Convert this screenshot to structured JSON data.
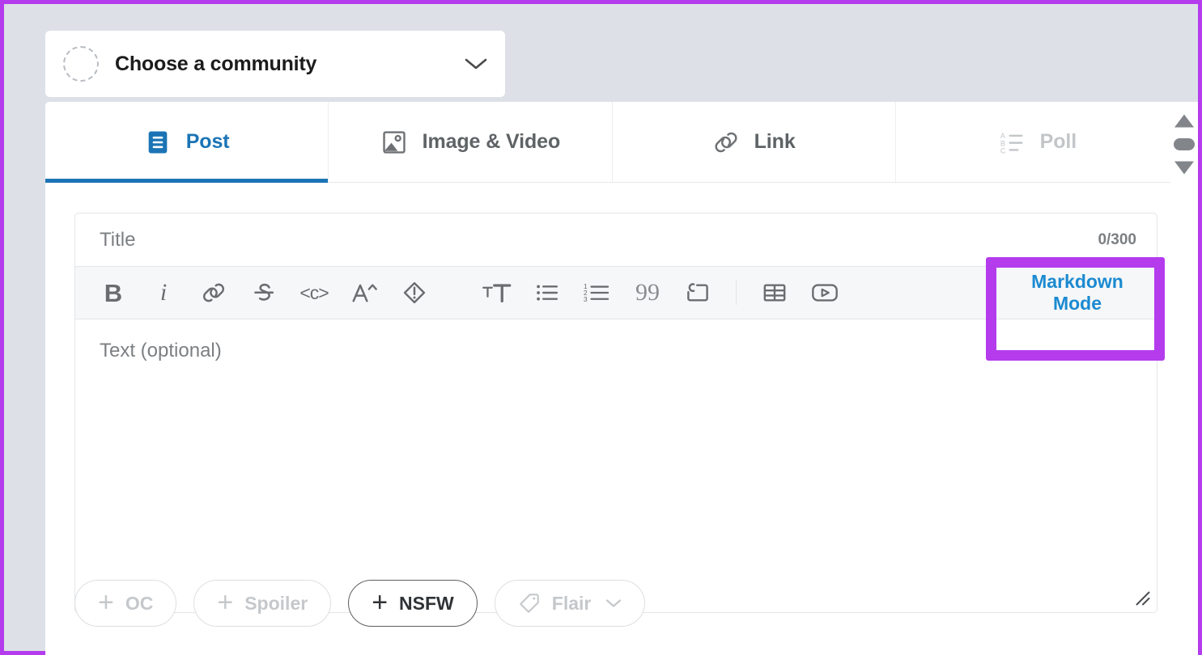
{
  "community": {
    "placeholder": "Choose a community",
    "avatar_icon": "dashed-circle-avatar",
    "chevron_icon": "chevron-down-icon"
  },
  "tabs": [
    {
      "label": "Post",
      "icon": "post-document-icon",
      "state": "active"
    },
    {
      "label": "Image & Video",
      "icon": "image-video-icon",
      "state": "default"
    },
    {
      "label": "Link",
      "icon": "link-chain-icon",
      "state": "default"
    },
    {
      "label": "Poll",
      "icon": "poll-list-icon",
      "state": "disabled"
    }
  ],
  "scrollbar": {
    "up_arrow_icon": "scroll-up-arrow-icon",
    "thumb_icon": "scroll-thumb",
    "down_arrow_icon": "scroll-down-arrow-icon"
  },
  "title_field": {
    "placeholder": "Title",
    "value": "",
    "counter": "0/300"
  },
  "toolbar": {
    "items": [
      {
        "name": "bold",
        "glyph": "B",
        "label": "Bold"
      },
      {
        "name": "italic",
        "glyph": "i",
        "label": "Italic"
      },
      {
        "name": "link",
        "glyph": "",
        "label": "Link"
      },
      {
        "name": "strikethrough",
        "glyph": "",
        "label": "Strikethrough"
      },
      {
        "name": "inline-code",
        "glyph": "<c>",
        "label": "Inline Code"
      },
      {
        "name": "superscript",
        "glyph": "",
        "label": "Superscript"
      },
      {
        "name": "spoiler",
        "glyph": "",
        "label": "Spoiler"
      },
      {
        "name": "heading",
        "glyph": "",
        "label": "Heading"
      },
      {
        "name": "bulleted-list",
        "glyph": "",
        "label": "Bulleted List"
      },
      {
        "name": "numbered-list",
        "glyph": "",
        "label": "Numbered List"
      },
      {
        "name": "quote",
        "glyph": "99",
        "label": "Quote Block"
      },
      {
        "name": "code-block",
        "glyph": "",
        "label": "Code Block"
      },
      {
        "name": "table",
        "glyph": "",
        "label": "Table"
      },
      {
        "name": "video",
        "glyph": "",
        "label": "Video"
      }
    ],
    "markdown_mode_line1": "Markdown",
    "markdown_mode_line2": "Mode"
  },
  "body_field": {
    "placeholder": "Text (optional)",
    "value": "",
    "resize_handle_icon": "resize-handle-icon"
  },
  "pills": [
    {
      "label": "OC",
      "icon": "plus-icon",
      "state": "muted"
    },
    {
      "label": "Spoiler",
      "icon": "plus-icon",
      "state": "muted"
    },
    {
      "label": "NSFW",
      "icon": "plus-icon",
      "state": "strong"
    },
    {
      "label": "Flair",
      "icon": "tag-icon",
      "state": "muted",
      "chevron": "chevron-down-icon"
    }
  ],
  "colors": {
    "accent_blue": "#1b74b5",
    "markdown_blue": "#1b8ad1",
    "annotation_purple": "#b43ced",
    "page_background": "#dde1e7",
    "toolbar_background": "#f6f7f8"
  }
}
